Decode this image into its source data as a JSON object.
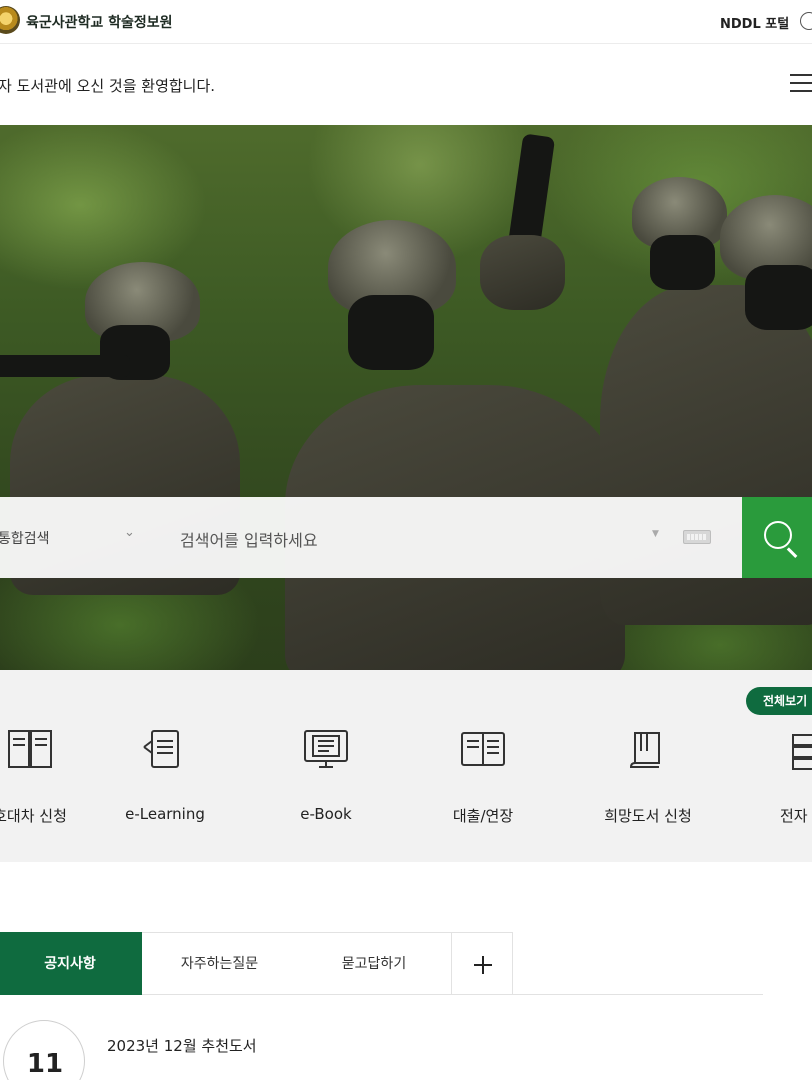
{
  "header": {
    "site_title": "육군사관학교 학술정보원",
    "portal_link": "NDDL 포털"
  },
  "welcome": {
    "message": "자 도서관에 오신 것을 환영합니다."
  },
  "search": {
    "category": "통합검색",
    "placeholder": "검색어를 입력하세요"
  },
  "quick_menu": {
    "view_all": "전체보기",
    "items": [
      {
        "label": "호대차 신청",
        "icon": "book-pages-icon"
      },
      {
        "label": "e-Learning",
        "icon": "document-pen-icon"
      },
      {
        "label": "e-Book",
        "icon": "ebook-monitor-icon"
      },
      {
        "label": "대출/연장",
        "icon": "open-book-icon"
      },
      {
        "label": "희망도서 신청",
        "icon": "book-request-icon"
      },
      {
        "label": "전자",
        "icon": "stack-books-icon"
      }
    ]
  },
  "tabs": {
    "items": [
      "공지사항",
      "자주하는질문",
      "묻고답하기"
    ]
  },
  "notices": [
    {
      "day": "11",
      "title": "2023년 12월 추천도서"
    }
  ],
  "colors": {
    "brand_green": "#0f6b3f",
    "search_green": "#2a9b3c"
  }
}
